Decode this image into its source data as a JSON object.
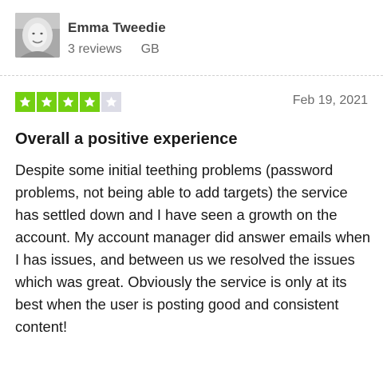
{
  "user": {
    "name": "Emma Tweedie",
    "reviews_count": "3 reviews",
    "country": "GB",
    "avatar_icon": "user-photo-avatar"
  },
  "review": {
    "rating": 4,
    "max_rating": 5,
    "date": "Feb 19, 2021",
    "title": "Overall a positive experience",
    "body": "Despite some initial teething problems (password problems, not being able to add targets) the service has settled down and I have seen a growth on the account. My account manager did answer emails when I has issues, and between us we resolved the issues which was great. Obviously the service is only at its best when the user is posting good and consistent content!"
  },
  "colors": {
    "star_filled": "#73cf11",
    "star_empty": "#dcdce6"
  }
}
